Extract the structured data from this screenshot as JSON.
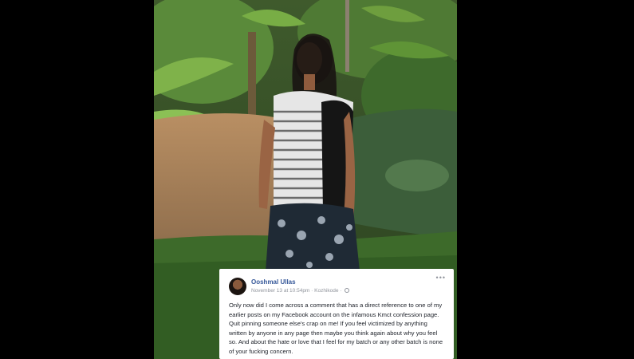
{
  "post": {
    "author": "Ooshmal Ullas",
    "timestamp": "November 13 at 10:54pm",
    "separator": "·",
    "location": "Kozhikode",
    "privacy_icon": "globe-icon",
    "more_icon": "•••",
    "body": "Only now did I come across a comment that has a direct reference to one of my earlier posts on my Facebook account on the infamous Kmct confession page. Quit pinning someone else's crap on me! If you feel victimized by anything written by anyone in any page then maybe you think again about why you feel so. And about the hate or love that I feel for my batch or any other batch is none of your fucking concern."
  },
  "colors": {
    "background": "#000000",
    "card": "#ffffff",
    "author_link": "#365899",
    "meta_text": "#90949c",
    "body_text": "#1d2129"
  }
}
